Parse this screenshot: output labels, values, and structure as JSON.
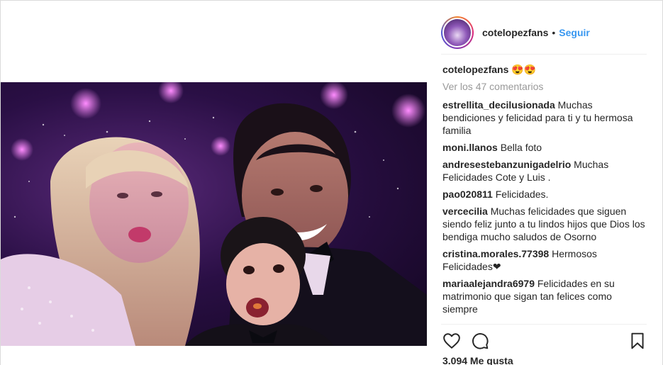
{
  "post": {
    "username": "cotelopezfans",
    "follow_label": "Seguir",
    "dot": "•"
  },
  "caption": {
    "username": "cotelopezfans",
    "text": "😍😍"
  },
  "view_all_label": "Ver los 47 comentarios",
  "comments": [
    {
      "user": "estrellita_decilusionada",
      "text": "Muchas bendiciones y felicidad para ti y tu hermosa familia"
    },
    {
      "user": "moni.llanos",
      "text": "Bella foto"
    },
    {
      "user": "andresestebanzunigadelrio",
      "text": "Muchas Felicidades Cote y Luis ."
    },
    {
      "user": "pao020811",
      "text": "Felicidades."
    },
    {
      "user": "vercecilia",
      "text": "Muchas felicidades que siguen siendo feliz junto a tu lindos hijos que Dios los bendiga mucho saludos de Osorno"
    },
    {
      "user": "cristina.morales.77398",
      "text": "Hermosos Felicidades❤"
    },
    {
      "user": "mariaalejandra6979",
      "text": "Felicidades en su matrimonio que sigan tan felices como siempre"
    }
  ],
  "likes_label": "3.094 Me gusta",
  "icons": {
    "like": "heart-icon",
    "comment": "comment-icon",
    "save": "bookmark-icon"
  },
  "colors": {
    "link_blue": "#3897f0",
    "muted": "#999999",
    "text": "#262626"
  }
}
